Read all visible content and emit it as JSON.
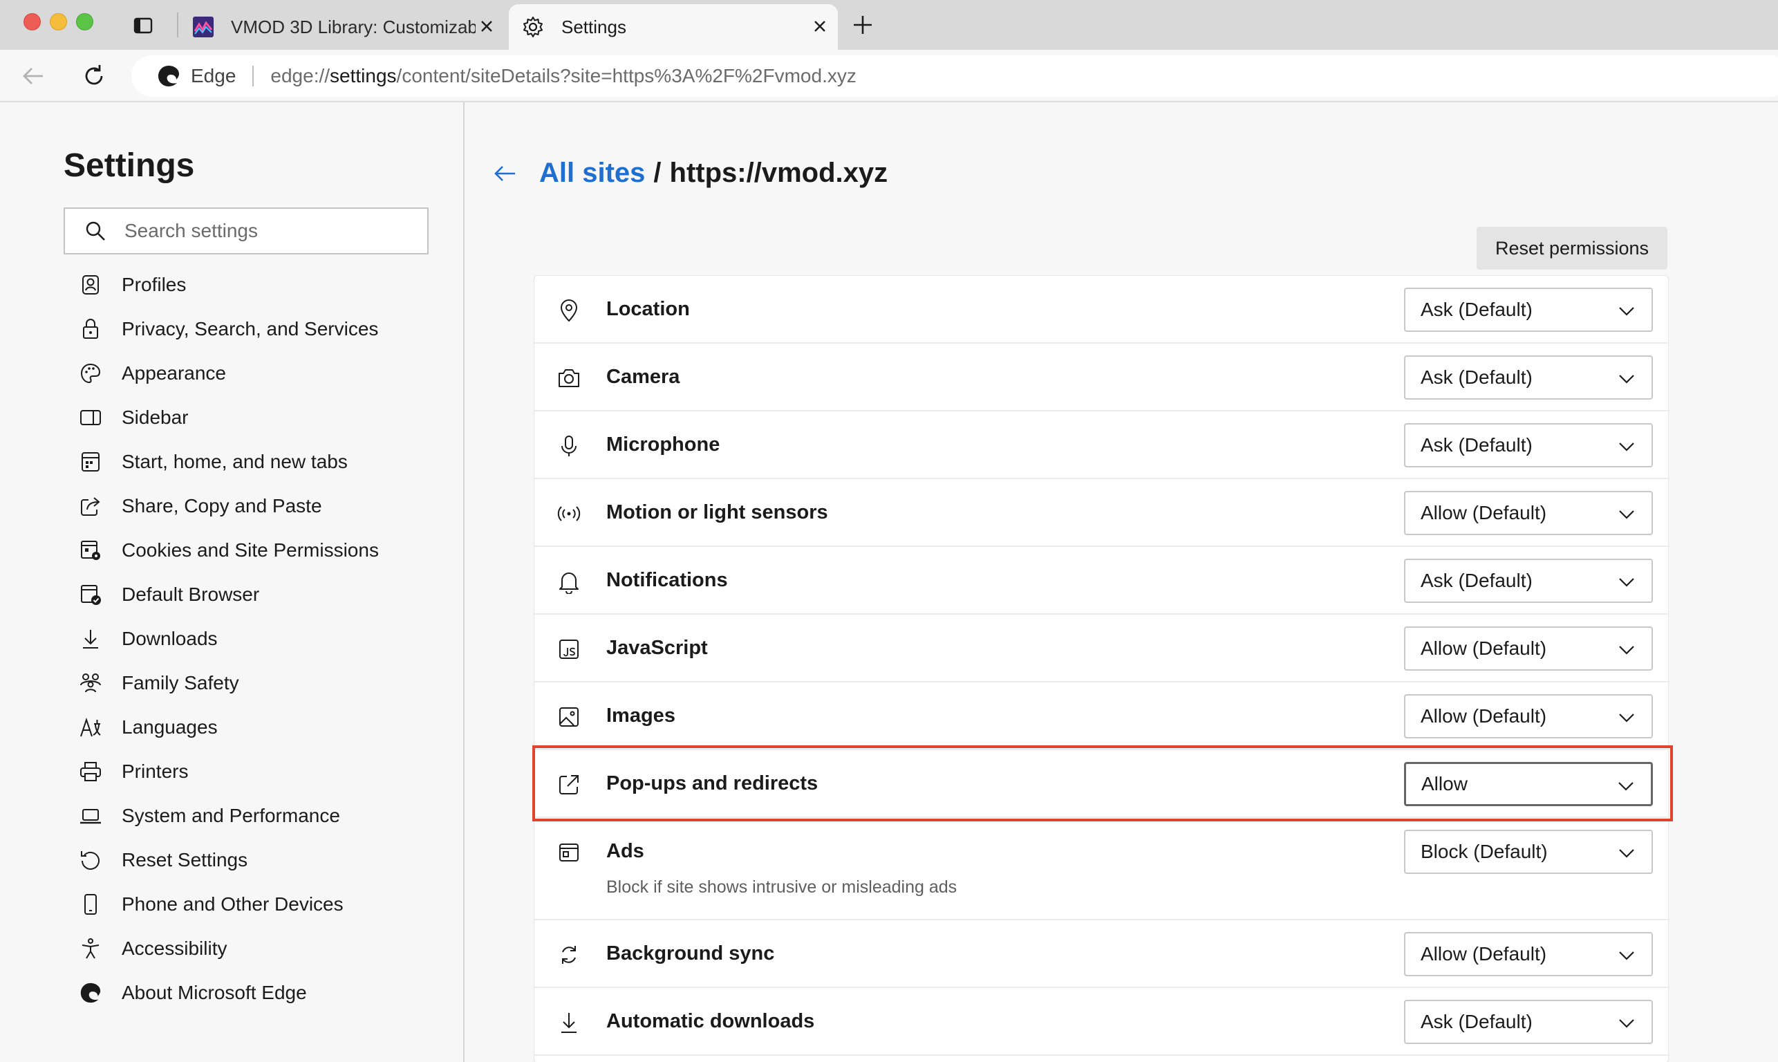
{
  "browser": {
    "tabs": [
      {
        "title": "VMOD 3D Library: Customizab",
        "active": false,
        "favicon": "vmod-logo-icon"
      },
      {
        "title": "Settings",
        "active": true,
        "favicon": "gear-icon"
      }
    ],
    "address_label": "Edge",
    "url_prefix": "edge://",
    "url_host": "settings",
    "url_rest": "/content/siteDetails?site=https%3A%2F%2Fvmod.xyz"
  },
  "sidebar": {
    "title": "Settings",
    "search_placeholder": "Search settings",
    "items": [
      {
        "label": "Profiles",
        "icon": "profile-icon"
      },
      {
        "label": "Privacy, Search, and Services",
        "icon": "lock-icon"
      },
      {
        "label": "Appearance",
        "icon": "palette-icon"
      },
      {
        "label": "Sidebar",
        "icon": "sidebar-icon"
      },
      {
        "label": "Start, home, and new tabs",
        "icon": "home-grid-icon"
      },
      {
        "label": "Share, Copy and Paste",
        "icon": "share-icon"
      },
      {
        "label": "Cookies and Site Permissions",
        "icon": "cookies-icon"
      },
      {
        "label": "Default Browser",
        "icon": "default-browser-icon"
      },
      {
        "label": "Downloads",
        "icon": "download-icon"
      },
      {
        "label": "Family Safety",
        "icon": "family-icon"
      },
      {
        "label": "Languages",
        "icon": "languages-icon"
      },
      {
        "label": "Printers",
        "icon": "printer-icon"
      },
      {
        "label": "System and Performance",
        "icon": "laptop-icon"
      },
      {
        "label": "Reset Settings",
        "icon": "reset-icon"
      },
      {
        "label": "Phone and Other Devices",
        "icon": "phone-icon"
      },
      {
        "label": "Accessibility",
        "icon": "accessibility-icon"
      },
      {
        "label": "About Microsoft Edge",
        "icon": "edge-logo-icon"
      }
    ]
  },
  "main": {
    "breadcrumb_link": "All sites",
    "breadcrumb_sep": "/",
    "site": "https://vmod.xyz",
    "reset_button": "Reset permissions",
    "permissions": [
      {
        "name": "Location",
        "value": "Ask (Default)",
        "icon": "location-icon"
      },
      {
        "name": "Camera",
        "value": "Ask (Default)",
        "icon": "camera-icon"
      },
      {
        "name": "Microphone",
        "value": "Ask (Default)",
        "icon": "microphone-icon"
      },
      {
        "name": "Motion or light sensors",
        "value": "Allow (Default)",
        "icon": "sensors-icon"
      },
      {
        "name": "Notifications",
        "value": "Ask (Default)",
        "icon": "bell-icon"
      },
      {
        "name": "JavaScript",
        "value": "Allow (Default)",
        "icon": "javascript-icon"
      },
      {
        "name": "Images",
        "value": "Allow (Default)",
        "icon": "image-icon"
      },
      {
        "name": "Pop-ups and redirects",
        "value": "Allow",
        "icon": "popup-icon",
        "highlighted": true
      },
      {
        "name": "Ads",
        "value": "Block (Default)",
        "icon": "ads-icon",
        "description": "Block if site shows intrusive or misleading ads"
      },
      {
        "name": "Background sync",
        "value": "Allow (Default)",
        "icon": "sync-icon"
      },
      {
        "name": "Automatic downloads",
        "value": "Ask (Default)",
        "icon": "download-icon"
      }
    ]
  },
  "colors": {
    "accent_link": "#1f6fd1",
    "highlight_border": "#e0432e"
  }
}
